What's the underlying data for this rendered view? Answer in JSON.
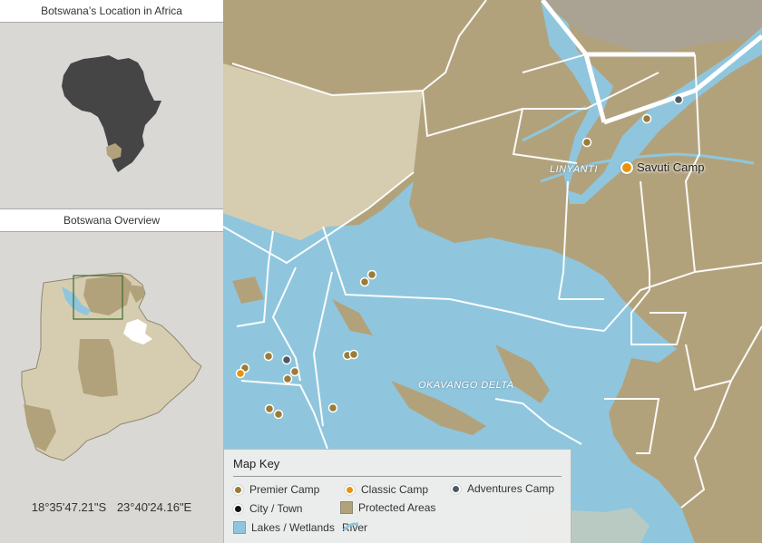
{
  "sidebar": {
    "africa_title": "Botswana’s Location in Africa",
    "overview_title": "Botswana Overview",
    "coords": {
      "lat": "18°35'47.21\"S",
      "lon": "23°40'24.16\"E"
    }
  },
  "map": {
    "labels": {
      "linyanti": "LINYANTI",
      "okavango": "OKAVANGO DELTA"
    },
    "featured_camp": {
      "name": "Savuti Camp",
      "type": "classic"
    }
  },
  "key": {
    "title": "Map Key",
    "items": {
      "premier": "Premier Camp",
      "classic": "Classic Camp",
      "adventures": "Adventures Camp",
      "city": "City / Town",
      "protected": "Protected Areas",
      "lakes": "Lakes / Wetlands",
      "river": "River"
    }
  },
  "colors": {
    "premier": "#9b7b35",
    "classic": "#e8930f",
    "adventures": "#4d5a63",
    "city": "#111111",
    "protected": "#b2a27c",
    "water": "#8fc6dd",
    "land_light": "#d6cdb0",
    "sidebar": "#d9d8d5"
  }
}
